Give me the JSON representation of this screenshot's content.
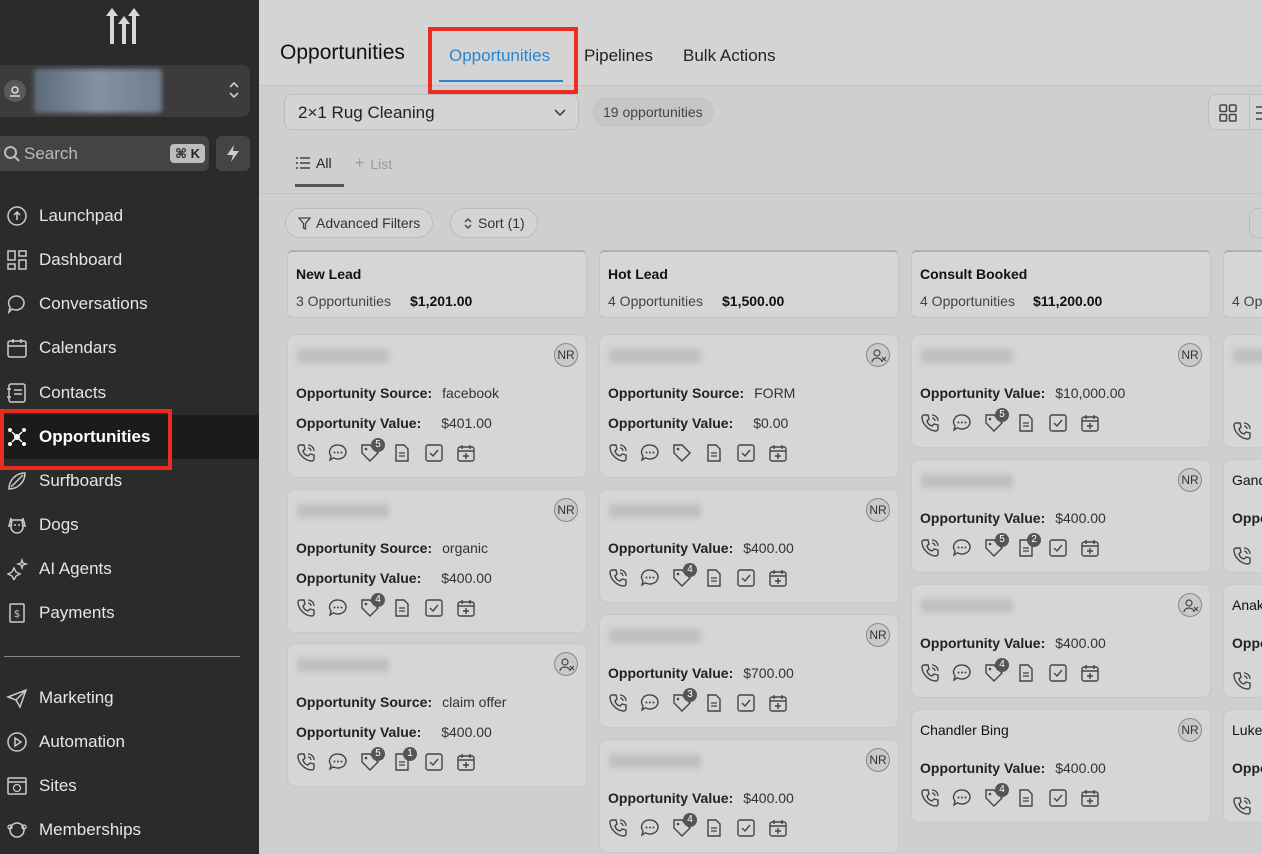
{
  "sidebar": {
    "search_placeholder": "Search",
    "search_shortcut": "⌘ K",
    "items": [
      {
        "label": "Launchpad",
        "icon": "launchpad-icon"
      },
      {
        "label": "Dashboard",
        "icon": "dashboard-icon"
      },
      {
        "label": "Conversations",
        "icon": "chat-icon"
      },
      {
        "label": "Calendars",
        "icon": "calendar-icon"
      },
      {
        "label": "Contacts",
        "icon": "contacts-icon"
      },
      {
        "label": "Opportunities",
        "icon": "opportunities-icon",
        "active": true
      },
      {
        "label": "Surfboards",
        "icon": "surfboard-icon"
      },
      {
        "label": "Dogs",
        "icon": "dog-icon"
      },
      {
        "label": "AI Agents",
        "icon": "sparkle-icon"
      },
      {
        "label": "Payments",
        "icon": "payments-icon"
      },
      {
        "label": "Marketing",
        "icon": "send-icon"
      },
      {
        "label": "Automation",
        "icon": "play-icon"
      },
      {
        "label": "Sites",
        "icon": "globe-icon"
      },
      {
        "label": "Memberships",
        "icon": "membership-icon"
      }
    ]
  },
  "header": {
    "title": "Opportunities",
    "tabs": [
      "Opportunities",
      "Pipelines",
      "Bulk Actions"
    ]
  },
  "toolbar": {
    "pipeline": "2×1 Rug Cleaning",
    "count": "19 opportunities",
    "subtab_all": "All",
    "subtab_list": "List",
    "advanced_filters": "Advanced Filters",
    "sort": "Sort (1)"
  },
  "labels": {
    "source": "Opportunity Source:",
    "value": "Opportunity Value:",
    "nr": "NR"
  },
  "columns": [
    {
      "title": "New Lead",
      "count": "3 Opportunities",
      "amount": "$1,201.00",
      "cards": [
        {
          "source": "facebook",
          "value": "$401.00",
          "avatar": "NR",
          "badges": {
            "tag": "5"
          }
        },
        {
          "source": "organic",
          "value": "$400.00",
          "avatar": "NR",
          "badges": {
            "tag": "4"
          }
        },
        {
          "source": "claim offer",
          "value": "$400.00",
          "avatar": "user-x",
          "badges": {
            "tag": "5",
            "notes": "1"
          }
        }
      ]
    },
    {
      "title": "Hot Lead",
      "count": "4 Opportunities",
      "amount": "$1,500.00",
      "cards": [
        {
          "source": "FORM",
          "value": "$0.00",
          "avatar": "user-x",
          "badges": {}
        },
        {
          "value": "$400.00",
          "avatar": "NR",
          "badges": {
            "tag": "4"
          }
        },
        {
          "value": "$700.00",
          "avatar": "NR",
          "badges": {
            "tag": "3"
          }
        },
        {
          "value": "$400.00",
          "avatar": "NR",
          "badges": {
            "tag": "4"
          }
        }
      ]
    },
    {
      "title": "Consult Booked",
      "count": "4 Opportunities",
      "amount": "$11,200.00",
      "cards": [
        {
          "value": "$10,000.00",
          "avatar": "NR",
          "badges": {
            "tag": "5"
          }
        },
        {
          "value": "$400.00",
          "avatar": "NR",
          "badges": {
            "tag": "5",
            "notes": "2"
          }
        },
        {
          "value": "$400.00",
          "avatar": "user-x",
          "badges": {
            "tag": "4"
          }
        },
        {
          "name": "Chandler Bing",
          "value": "$400.00",
          "avatar": "NR",
          "badges": {
            "tag": "4"
          }
        }
      ]
    },
    {
      "count": "4 Op",
      "names": [
        "Gand",
        "Anak",
        "Luke"
      ],
      "row_label": "Oppo"
    }
  ]
}
